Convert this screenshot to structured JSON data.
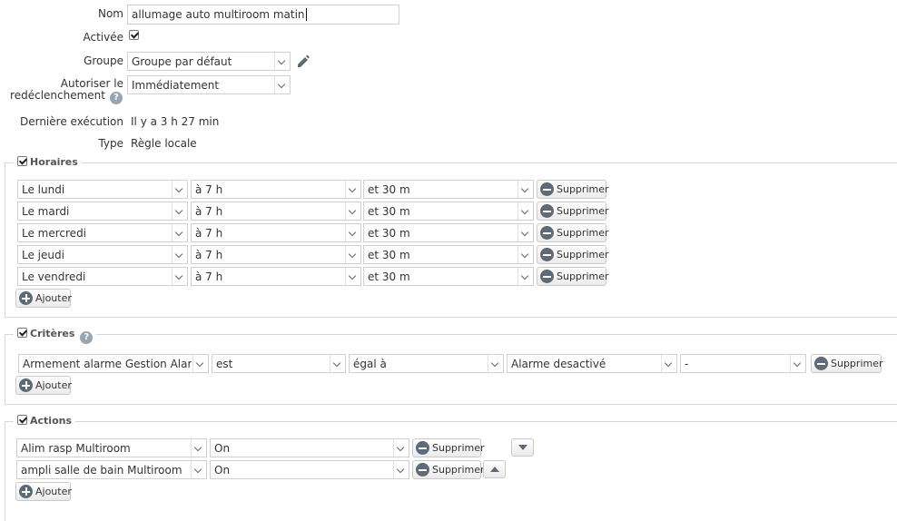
{
  "form": {
    "nom_label": "Nom",
    "nom_value": "allumage auto multiroom matin",
    "activee_label": "Activée",
    "groupe_label": "Groupe",
    "groupe_value": "Groupe par défaut",
    "autoriser_label_1": "Autoriser le",
    "autoriser_label_2": "redéclenchement",
    "autoriser_value": "Immédiatement",
    "derniere_label": "Dernière exécution",
    "derniere_value": "Il y a 3 h 27 min",
    "type_label": "Type",
    "type_value": "Règle locale"
  },
  "horaires": {
    "title": "Horaires",
    "rows": [
      {
        "day": "Le lundi",
        "hour": "à 7 h",
        "minute": "et 30 m"
      },
      {
        "day": "Le mardi",
        "hour": "à 7 h",
        "minute": "et 30 m"
      },
      {
        "day": "Le mercredi",
        "hour": "à 7 h",
        "minute": "et 30 m"
      },
      {
        "day": "Le jeudi",
        "hour": "à 7 h",
        "minute": "et 30 m"
      },
      {
        "day": "Le vendredi",
        "hour": "à 7 h",
        "minute": "et 30 m"
      }
    ],
    "delete_label": "Supprimer",
    "add_label": "Ajouter"
  },
  "criteres": {
    "title": "Critères",
    "row": {
      "subject": "Armement alarme Gestion Alarme",
      "verb": "est",
      "operator": "égal à",
      "value": "Alarme desactivé",
      "extra": "-"
    },
    "delete_label": "Supprimer",
    "add_label": "Ajouter"
  },
  "actions": {
    "title": "Actions",
    "rows": [
      {
        "device": "Alim rasp Multiroom",
        "value": "On"
      },
      {
        "device": "ampli salle de bain Multiroom",
        "value": "On"
      }
    ],
    "delete_label": "Supprimer",
    "add_label": "Ajouter"
  },
  "icons": {
    "help": "help-icon",
    "edit": "pencil-icon",
    "remove": "minus-circle-icon",
    "add": "plus-circle-icon",
    "move_down": "arrow-down-icon",
    "move_up": "arrow-up-icon"
  }
}
